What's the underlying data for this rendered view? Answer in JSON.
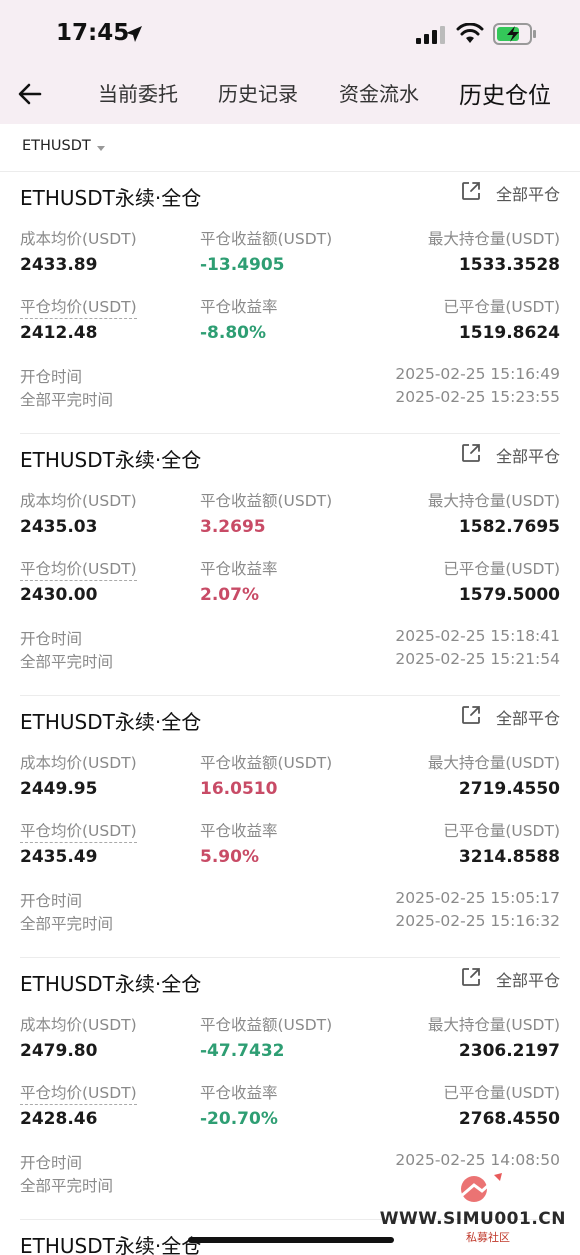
{
  "status_bar": {
    "time": "17:45"
  },
  "nav": {
    "tabs": [
      "当前委托",
      "历史记录",
      "资金流水",
      "历史仓位"
    ],
    "active_tab": "历史仓位"
  },
  "filter": {
    "symbol": "ETHUSDT"
  },
  "labels": {
    "avg_cost": "成本均价(USDT)",
    "realized_pnl": "平仓收益额(USDT)",
    "max_position": "最大持仓量(USDT)",
    "close_avg": "平仓均价(USDT)",
    "pnl_rate": "平仓收益率",
    "closed_qty": "已平仓量(USDT)",
    "open_time": "开仓时间",
    "full_close_time": "全部平完时间",
    "close_all": "全部平仓"
  },
  "positions": [
    {
      "title": "ETHUSDT永续·全仓",
      "avg_cost": "2433.89",
      "realized_pnl": "-13.4905",
      "pnl_dir": "green",
      "max_position": "1533.3528",
      "close_avg": "2412.48",
      "pnl_rate": "-8.80%",
      "closed_qty": "1519.8624",
      "open_time": "2025-02-25 15:16:49",
      "full_close_time": "2025-02-25 15:23:55"
    },
    {
      "title": "ETHUSDT永续·全仓",
      "avg_cost": "2435.03",
      "realized_pnl": "3.2695",
      "pnl_dir": "red",
      "max_position": "1582.7695",
      "close_avg": "2430.00",
      "pnl_rate": "2.07%",
      "closed_qty": "1579.5000",
      "open_time": "2025-02-25 15:18:41",
      "full_close_time": "2025-02-25 15:21:54"
    },
    {
      "title": "ETHUSDT永续·全仓",
      "avg_cost": "2449.95",
      "realized_pnl": "16.0510",
      "pnl_dir": "red",
      "max_position": "2719.4550",
      "close_avg": "2435.49",
      "pnl_rate": "5.90%",
      "closed_qty": "3214.8588",
      "open_time": "2025-02-25 15:05:17",
      "full_close_time": "2025-02-25 15:16:32"
    },
    {
      "title": "ETHUSDT永续·全仓",
      "avg_cost": "2479.80",
      "realized_pnl": "-47.7432",
      "pnl_dir": "green",
      "max_position": "2306.2197",
      "close_avg": "2428.46",
      "pnl_rate": "-20.70%",
      "closed_qty": "2768.4550",
      "open_time": "2025-02-25 14:08:50",
      "full_close_time": ""
    },
    {
      "title": "ETHUSDT永续·全仓"
    }
  ],
  "watermark": {
    "url": "WWW.SIMU001.CN",
    "subtitle": "私募社区"
  },
  "colors": {
    "header_bg": "#f6eef3",
    "profit": "#c84b66",
    "loss": "#2e9e73"
  },
  "icons": [
    "back-arrow-icon",
    "location-arrow-icon",
    "signal-icon",
    "wifi-icon",
    "battery-charging-icon",
    "external-link-icon",
    "dropdown-caret-icon"
  ]
}
